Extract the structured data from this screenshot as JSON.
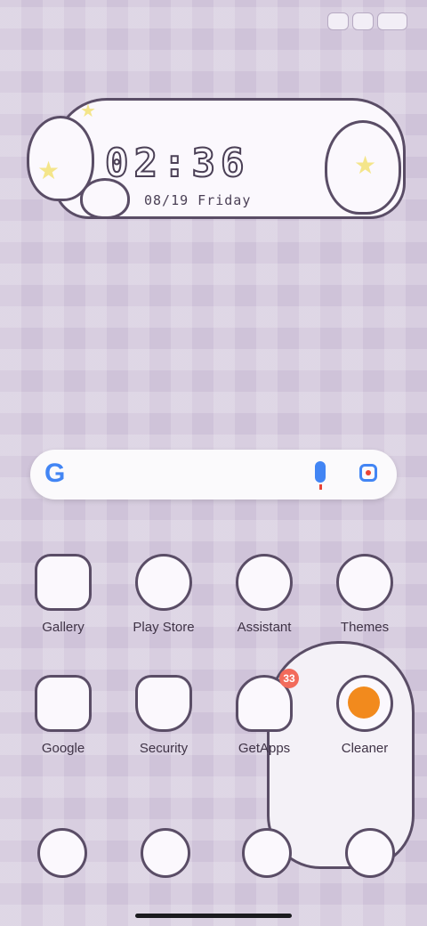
{
  "status_bar": {
    "icons": [
      "bunny-sticker-icon",
      "carrot-bunny-icon",
      "sleeping-bunny-icon"
    ]
  },
  "clock": {
    "time": "02:36",
    "date": "08/19  Friday"
  },
  "search": {
    "google_glyph": "G"
  },
  "apps_row1": [
    {
      "label": "Gallery",
      "icon": "gallery-bunny-icon"
    },
    {
      "label": "Play Store",
      "icon": "play-store-icon"
    },
    {
      "label": "Assistant",
      "icon": "assistant-icon"
    },
    {
      "label": "Themes",
      "icon": "palette-icon"
    }
  ],
  "apps_row2": [
    {
      "label": "Google",
      "icon": "google-folder-icon"
    },
    {
      "label": "Security",
      "icon": "shield-lightning-icon"
    },
    {
      "label": "GetApps",
      "icon": "mushroom-icon",
      "badge": "33"
    },
    {
      "label": "Cleaner",
      "icon": "broom-icon"
    }
  ],
  "dock": [
    "phone-moon-icon",
    "heart-message-icon",
    "chrome-icon",
    "camera-bunny-icon"
  ]
}
